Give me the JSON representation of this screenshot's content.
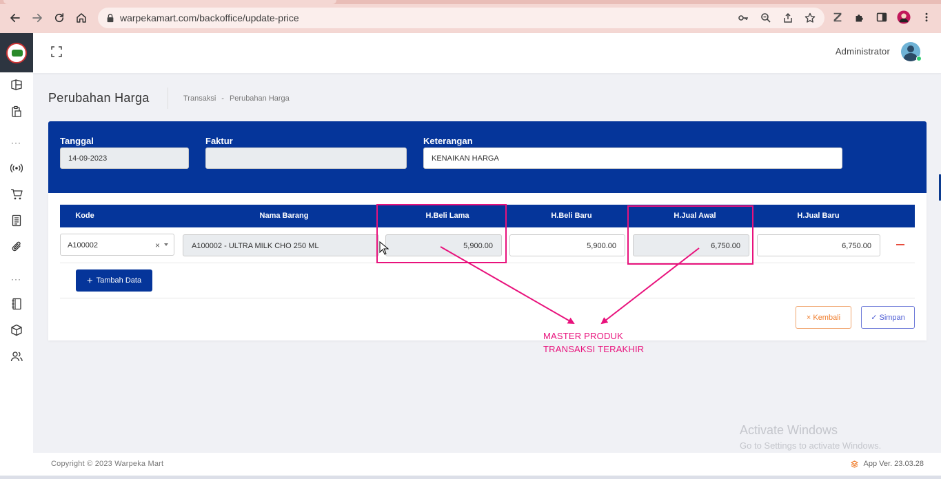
{
  "browser": {
    "url": "warpekamart.com/backoffice/update-price"
  },
  "topbar": {
    "username": "Administrator"
  },
  "page": {
    "title": "Perubahan Harga",
    "breadcrumb": [
      "Transaksi",
      "-",
      "Perubahan Harga"
    ]
  },
  "form": {
    "tanggal_label": "Tanggal",
    "tanggal_value": "14-09-2023",
    "faktur_label": "Faktur",
    "faktur_value": "",
    "keterangan_label": "Keterangan",
    "keterangan_value": "KENAIKAN HARGA"
  },
  "table": {
    "headers": [
      "Kode",
      "Nama Barang",
      "H.Beli Lama",
      "H.Beli Baru",
      "H.Jual Awal",
      "H.Jual Baru"
    ],
    "rows": [
      {
        "kode": "A100002",
        "clear": "×",
        "nama_barang": "A100002 - ULTRA MILK CHO 250 ML",
        "h_beli_lama": "5,900.00",
        "h_beli_baru": "5,900.00",
        "h_jual_awal": "6,750.00",
        "h_jual_baru": "6,750.00"
      }
    ]
  },
  "buttons": {
    "add_label": "Tambah Data",
    "add_plus": "+",
    "back_label": "× Kembali",
    "save_label": "✓ Simpan"
  },
  "annotation": {
    "line1": "MASTER PRODUK",
    "line2": "TRANSAKSI TERAKHIR",
    "color": "#e8127c"
  },
  "watermark": {
    "title": "Activate Windows",
    "subtitle": "Go to Settings to activate Windows."
  },
  "footer": {
    "copyright": "Copyright © 2023 Warpeka Mart",
    "version": "App Ver. 23.03.28"
  },
  "colors": {
    "primary": "#05359a",
    "danger": "#e74c3c",
    "warning": "#f07d2c",
    "indigo": "#4c5bd4"
  }
}
